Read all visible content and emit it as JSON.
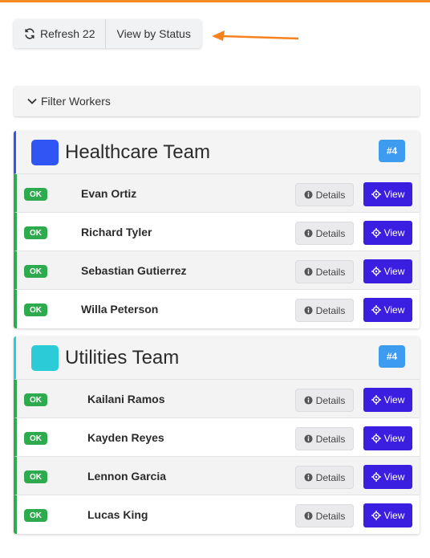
{
  "toolbar": {
    "refresh_label": "Refresh 22",
    "view_status_label": "View by Status"
  },
  "filter": {
    "label": "Filter Workers"
  },
  "colors": {
    "accent_top": "#f58a1f",
    "ok": "#2eaa4f",
    "view_button": "#3b1fe0",
    "badge": "#3d9cf0"
  },
  "teams": [
    {
      "name": "Healthcare Team",
      "color": "#2f55f5",
      "badge": "#4",
      "workers": [
        {
          "status": "OK",
          "name": "Evan Ortiz"
        },
        {
          "status": "OK",
          "name": "Richard Tyler"
        },
        {
          "status": "OK",
          "name": "Sebastian Gutierrez"
        },
        {
          "status": "OK",
          "name": "Willa Peterson"
        }
      ]
    },
    {
      "name": "Utilities Team",
      "color": "#2bcbd8",
      "badge": "#4",
      "workers": [
        {
          "status": "OK",
          "name": "Kailani Ramos"
        },
        {
          "status": "OK",
          "name": "Kayden Reyes"
        },
        {
          "status": "OK",
          "name": "Lennon Garcia"
        },
        {
          "status": "OK",
          "name": "Lucas King"
        }
      ]
    }
  ],
  "actions": {
    "details_label": "Details",
    "view_label": "View"
  },
  "icons": {
    "refresh": "refresh-icon",
    "chevron": "chevron-down-icon",
    "info": "info-icon",
    "target": "crosshair-icon"
  }
}
